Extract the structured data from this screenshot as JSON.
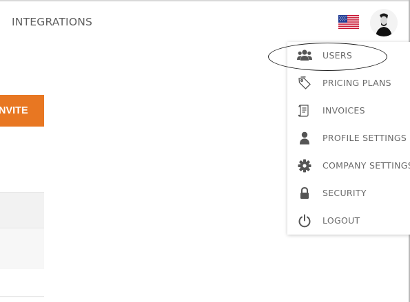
{
  "header": {
    "nav_integrations": "INTEGRATIONS",
    "language_flag": "us-flag-icon",
    "avatar": "user-avatar"
  },
  "main": {
    "invite_label": "NVITE"
  },
  "user_menu": {
    "items": [
      {
        "label": "USERS",
        "icon": "users-icon"
      },
      {
        "label": "PRICING PLANS",
        "icon": "tag-icon"
      },
      {
        "label": "INVOICES",
        "icon": "invoice-icon"
      },
      {
        "label": "PROFILE SETTINGS",
        "icon": "person-icon"
      },
      {
        "label": "COMPANY SETTINGS",
        "icon": "gear-icon"
      },
      {
        "label": "SECURITY",
        "icon": "lock-icon"
      },
      {
        "label": "LOGOUT",
        "icon": "power-icon"
      }
    ]
  },
  "colors": {
    "accent": "#e87722",
    "icon": "#555555",
    "text": "#6a6a6a"
  }
}
